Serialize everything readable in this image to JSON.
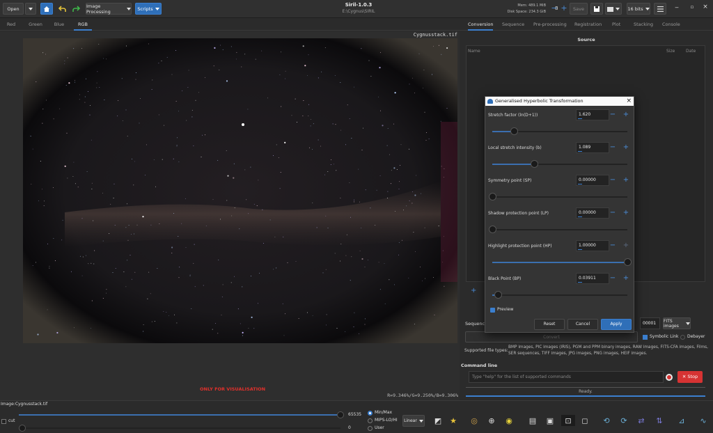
{
  "window": {
    "title": "Siril-1.0.3",
    "path": "E:\\Cygnus\\SIRIL"
  },
  "toolbar": {
    "open": "Open",
    "image_processing": "Image Processing",
    "scripts": "Scripts",
    "mem": "Mem: 489.1 MiB",
    "disk": "Disk Space: 234.3 GiB",
    "threads": "8",
    "save": "Save",
    "bits": "16 bits"
  },
  "view_tabs": [
    "Red",
    "Green",
    "Blue",
    "RGB"
  ],
  "image_name": "Cygnusstack.tif",
  "viz_note": "ONLY FOR VISUALISATION",
  "pixel_readout": "R=9.346%/G=9.250%/B=9.306%",
  "right_tabs": [
    "Conversion",
    "Sequence",
    "Pre-processing",
    "Registration",
    "Plot",
    "Stacking",
    "Console"
  ],
  "source": {
    "heading": "Source",
    "col_name": "Name",
    "col_size": "Size",
    "col_date": "Date"
  },
  "sequence": {
    "label": "Sequence",
    "number": "00001",
    "format": "FITS images",
    "symbolic_link": "Symbolic Link",
    "debayer": "Debayer",
    "convert": "Convert",
    "supported_label": "Supported file types:",
    "supported_text": "BMP images, PIC images (IRIS), PGM and PPM binary images, RAW images, FITS-CFA images, Films, SER sequences, TIFF images, JPG images, PNG images, HEIF images."
  },
  "command": {
    "label": "Command line",
    "placeholder": "Type \"help\" for the list of supported commands",
    "stop": "Stop",
    "status": "Ready."
  },
  "dialog": {
    "title": "Generalised Hyperbolic Transformation",
    "params": [
      {
        "label": "Stretch factor (ln(D+1))",
        "value": "1.620",
        "level": 0.16
      },
      {
        "label": "Local stretch intensity (b)",
        "value": "1.089",
        "level": 0.31
      },
      {
        "label": "Symmetry point (SP)",
        "value": "0.00000",
        "level": 0.0
      },
      {
        "label": "Shadow protection point (LP)",
        "value": "0.00000",
        "level": 0.0
      },
      {
        "label": "Highlight protection point (HP)",
        "value": "1.00000",
        "level": 1.0
      },
      {
        "label": "Black Point (BP)",
        "value": "0.03911",
        "level": 0.04
      }
    ],
    "preview": "Preview",
    "reset": "Reset",
    "cancel": "Cancel",
    "apply": "Apply"
  },
  "bottom": {
    "image_label": "Image:",
    "image_file": "Cygnusstack.tif",
    "max_value": "65535",
    "min_value": "0",
    "cut": "cut",
    "minmax": "Min/Max",
    "mips": "MIPS-LO/HI",
    "user": "User",
    "scale": "Linear"
  },
  "colors": {
    "accent": "#3b7fcf",
    "stop": "#d63333",
    "warning": "#e0312c"
  }
}
